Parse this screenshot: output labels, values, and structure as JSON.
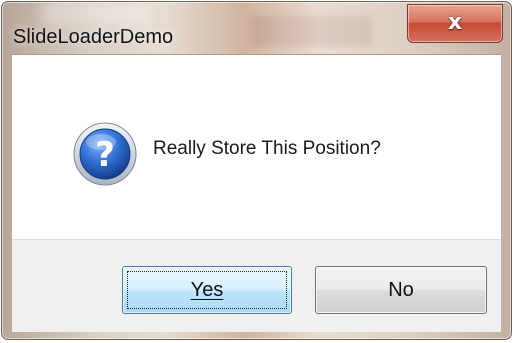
{
  "dialog": {
    "title": "SlideLoaderDemo",
    "close_label": "x",
    "message": "Really Store This Position?",
    "icon": "question-icon",
    "buttons": {
      "yes_accelerator": "Y",
      "yes_rest": "es",
      "no_label": "No"
    },
    "colors": {
      "close_button": "#c74a33",
      "icon_blue": "#1f5fb8",
      "focused_button": "#bee6fd"
    }
  }
}
